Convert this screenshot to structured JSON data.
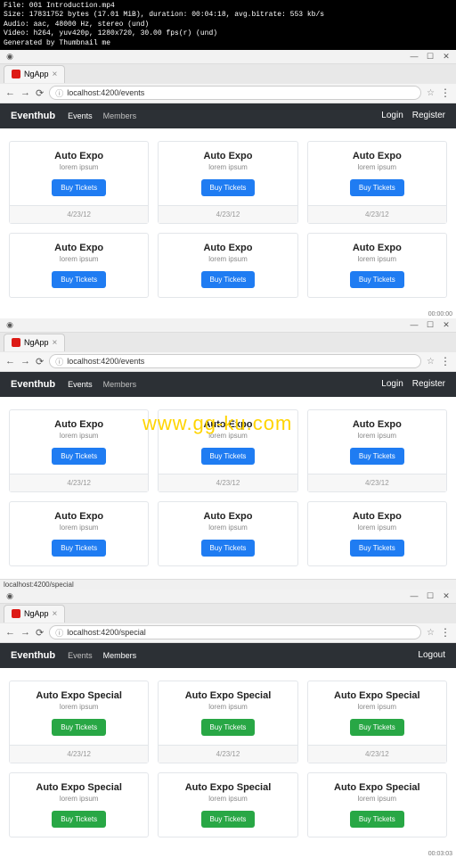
{
  "video_info": {
    "line1": "File: 001 Introduction.mp4",
    "line2": "Size: 17831752 bytes (17.01 MiB), duration: 00:04:18, avg.bitrate: 553 kb/s",
    "line3": "Audio: aac, 48000 Hz, stereo (und)",
    "line4": "Video: h264, yuv420p, 1280x720, 30.00 fps(r) (und)",
    "line5": "Generated by Thumbnail me"
  },
  "windows": [
    {
      "tab_title": "NgApp",
      "url": "localhost:4200/events",
      "nav": {
        "brand": "Eventhub",
        "links": [
          "Events",
          "Members"
        ],
        "active": "Events",
        "right": [
          "Login",
          "Register"
        ]
      },
      "cards": [
        {
          "title": "Auto Expo",
          "sub": "lorem ipsum",
          "btn": "Buy Tickets",
          "date": "4/23/12",
          "color": "blue",
          "footer": true
        },
        {
          "title": "Auto Expo",
          "sub": "lorem ipsum",
          "btn": "Buy Tickets",
          "date": "4/23/12",
          "color": "blue",
          "footer": true
        },
        {
          "title": "Auto Expo",
          "sub": "lorem ipsum",
          "btn": "Buy Tickets",
          "date": "4/23/12",
          "color": "blue",
          "footer": true
        },
        {
          "title": "Auto Expo",
          "sub": "lorem ipsum",
          "btn": "Buy Tickets",
          "color": "blue",
          "footer": false
        },
        {
          "title": "Auto Expo",
          "sub": "lorem ipsum",
          "btn": "Buy Tickets",
          "color": "blue",
          "footer": false
        },
        {
          "title": "Auto Expo",
          "sub": "lorem ipsum",
          "btn": "Buy Tickets",
          "color": "blue",
          "footer": false
        }
      ],
      "timestamp": "00:00:00"
    },
    {
      "tab_title": "NgApp",
      "url": "localhost:4200/events",
      "nav": {
        "brand": "Eventhub",
        "links": [
          "Events",
          "Members"
        ],
        "active": "Events",
        "right": [
          "Login",
          "Register"
        ]
      },
      "watermark": "www.gg-ku.com",
      "cards": [
        {
          "title": "Auto Expo",
          "sub": "lorem ipsum",
          "btn": "Buy Tickets",
          "date": "4/23/12",
          "color": "blue",
          "footer": true
        },
        {
          "title": "Auto Expo",
          "sub": "lorem ipsum",
          "btn": "Buy Tickets",
          "date": "4/23/12",
          "color": "blue",
          "footer": true
        },
        {
          "title": "Auto Expo",
          "sub": "lorem ipsum",
          "btn": "Buy Tickets",
          "date": "4/23/12",
          "color": "blue",
          "footer": true
        },
        {
          "title": "Auto Expo",
          "sub": "lorem ipsum",
          "btn": "Buy Tickets",
          "color": "blue",
          "footer": false
        },
        {
          "title": "Auto Expo",
          "sub": "lorem ipsum",
          "btn": "Buy Tickets",
          "color": "blue",
          "footer": false
        },
        {
          "title": "Auto Expo",
          "sub": "lorem ipsum",
          "btn": "Buy Tickets",
          "color": "blue",
          "footer": false
        }
      ],
      "status": "localhost:4200/special"
    },
    {
      "tab_title": "NgApp",
      "url": "localhost:4200/special",
      "nav": {
        "brand": "Eventhub",
        "links": [
          "Events",
          "Members"
        ],
        "active": "Members",
        "right": [
          "Logout"
        ]
      },
      "cards": [
        {
          "title": "Auto Expo Special",
          "sub": "lorem ipsum",
          "btn": "Buy Tickets",
          "date": "4/23/12",
          "color": "green",
          "footer": true
        },
        {
          "title": "Auto Expo Special",
          "sub": "lorem ipsum",
          "btn": "Buy Tickets",
          "date": "4/23/12",
          "color": "green",
          "footer": true
        },
        {
          "title": "Auto Expo Special",
          "sub": "lorem ipsum",
          "btn": "Buy Tickets",
          "date": "4/23/12",
          "color": "green",
          "footer": true
        },
        {
          "title": "Auto Expo Special",
          "sub": "lorem ipsum",
          "btn": "Buy Tickets",
          "color": "green",
          "footer": false
        },
        {
          "title": "Auto Expo Special",
          "sub": "lorem ipsum",
          "btn": "Buy Tickets",
          "color": "green",
          "footer": false
        },
        {
          "title": "Auto Expo Special",
          "sub": "lorem ipsum",
          "btn": "Buy Tickets",
          "color": "green",
          "footer": false
        }
      ],
      "timestamp": "00:03:03"
    }
  ]
}
